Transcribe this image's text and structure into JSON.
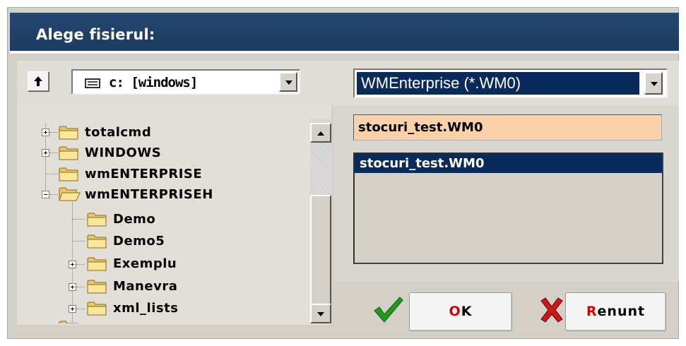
{
  "dialog": {
    "title": "Alege fisierul:"
  },
  "toolbar": {
    "drive": "c: [windows]",
    "filter": "WMEnterprise (*.WM0)"
  },
  "tree": {
    "items": [
      {
        "label": "totalcmd",
        "expander": "plus"
      },
      {
        "label": "WINDOWS",
        "expander": "plus"
      },
      {
        "label": "wmENTERPRISE",
        "expander": "none"
      },
      {
        "label": "wmENTERPRISEH",
        "expander": "minus"
      },
      {
        "label": "Demo",
        "expander": "none"
      },
      {
        "label": "Demo5",
        "expander": "none"
      },
      {
        "label": "Exemplu",
        "expander": "plus"
      },
      {
        "label": "Manevra",
        "expander": "plus"
      },
      {
        "label": "xml_lists",
        "expander": "plus"
      }
    ]
  },
  "file": {
    "name_value": "stocuri_test.WM0",
    "list": [
      "stocuri_test.WM0"
    ]
  },
  "buttons": {
    "ok_hot": "O",
    "ok_rest": "K",
    "cancel_hot": "R",
    "cancel_rest": "enunt"
  },
  "colors": {
    "title_bar": "#1d3c63",
    "selection": "#0a2a5c",
    "filename_bg": "#fbd1a9",
    "hotkey": "#d40000",
    "check": "#1f9a1f",
    "cancel_x": "#c81818"
  }
}
